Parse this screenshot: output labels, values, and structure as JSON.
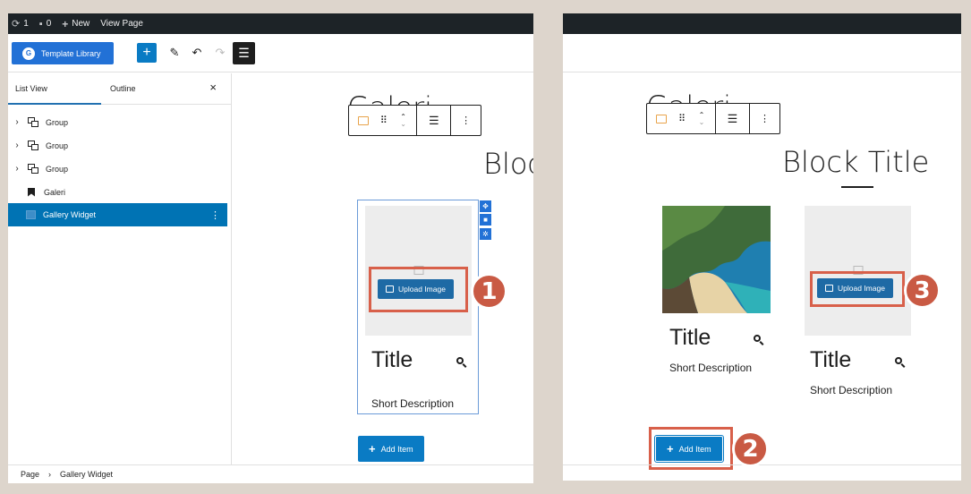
{
  "left": {
    "admin_bar": {
      "updates": "1",
      "comments": "0",
      "new_label": "New",
      "view_page": "View Page"
    },
    "toolbar": {
      "template_library": "Template Library"
    },
    "sidebar": {
      "tab_list_view": "List View",
      "tab_outline": "Outline",
      "close": "×",
      "items": [
        {
          "label": "Group"
        },
        {
          "label": "Group"
        },
        {
          "label": "Group"
        },
        {
          "label": "Galeri"
        },
        {
          "label": "Gallery Widget"
        }
      ]
    },
    "breadcrumb": {
      "page": "Page",
      "current": "Gallery Widget"
    },
    "canvas": {
      "heading": "Galeri",
      "block_title": "Bloc",
      "card": {
        "button": "Upload Image",
        "title": "Title",
        "description": "Short Description"
      },
      "add_item": "Add Item"
    }
  },
  "right": {
    "heading": "Galeri",
    "block_title": "Block Title",
    "cards": [
      {
        "title": "Title",
        "description": "Short Description"
      },
      {
        "button": "Upload Image",
        "title": "Title",
        "description": "Short Description"
      }
    ],
    "add_item": "Add Item"
  },
  "badges": [
    "1",
    "2",
    "3"
  ],
  "colors": {
    "accent": "#2271d6",
    "highlight": "#d8604a",
    "badge": "#c95a44",
    "selected_row": "#0073b4"
  }
}
